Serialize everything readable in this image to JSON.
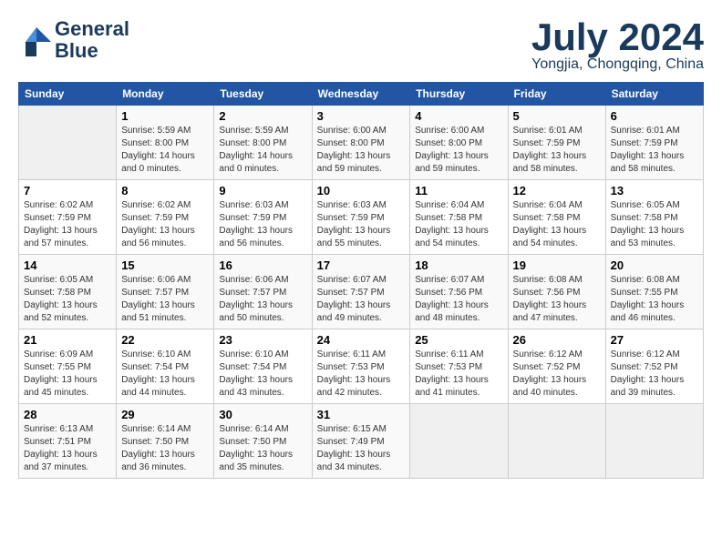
{
  "header": {
    "logo_line1": "General",
    "logo_line2": "Blue",
    "month_title": "July 2024",
    "location": "Yongjia, Chongqing, China"
  },
  "columns": [
    "Sunday",
    "Monday",
    "Tuesday",
    "Wednesday",
    "Thursday",
    "Friday",
    "Saturday"
  ],
  "weeks": [
    [
      {
        "day": "",
        "info": ""
      },
      {
        "day": "1",
        "info": "Sunrise: 5:59 AM\nSunset: 8:00 PM\nDaylight: 14 hours\nand 0 minutes."
      },
      {
        "day": "2",
        "info": "Sunrise: 5:59 AM\nSunset: 8:00 PM\nDaylight: 14 hours\nand 0 minutes."
      },
      {
        "day": "3",
        "info": "Sunrise: 6:00 AM\nSunset: 8:00 PM\nDaylight: 13 hours\nand 59 minutes."
      },
      {
        "day": "4",
        "info": "Sunrise: 6:00 AM\nSunset: 8:00 PM\nDaylight: 13 hours\nand 59 minutes."
      },
      {
        "day": "5",
        "info": "Sunrise: 6:01 AM\nSunset: 7:59 PM\nDaylight: 13 hours\nand 58 minutes."
      },
      {
        "day": "6",
        "info": "Sunrise: 6:01 AM\nSunset: 7:59 PM\nDaylight: 13 hours\nand 58 minutes."
      }
    ],
    [
      {
        "day": "7",
        "info": "Sunrise: 6:02 AM\nSunset: 7:59 PM\nDaylight: 13 hours\nand 57 minutes."
      },
      {
        "day": "8",
        "info": "Sunrise: 6:02 AM\nSunset: 7:59 PM\nDaylight: 13 hours\nand 56 minutes."
      },
      {
        "day": "9",
        "info": "Sunrise: 6:03 AM\nSunset: 7:59 PM\nDaylight: 13 hours\nand 56 minutes."
      },
      {
        "day": "10",
        "info": "Sunrise: 6:03 AM\nSunset: 7:59 PM\nDaylight: 13 hours\nand 55 minutes."
      },
      {
        "day": "11",
        "info": "Sunrise: 6:04 AM\nSunset: 7:58 PM\nDaylight: 13 hours\nand 54 minutes."
      },
      {
        "day": "12",
        "info": "Sunrise: 6:04 AM\nSunset: 7:58 PM\nDaylight: 13 hours\nand 54 minutes."
      },
      {
        "day": "13",
        "info": "Sunrise: 6:05 AM\nSunset: 7:58 PM\nDaylight: 13 hours\nand 53 minutes."
      }
    ],
    [
      {
        "day": "14",
        "info": "Sunrise: 6:05 AM\nSunset: 7:58 PM\nDaylight: 13 hours\nand 52 minutes."
      },
      {
        "day": "15",
        "info": "Sunrise: 6:06 AM\nSunset: 7:57 PM\nDaylight: 13 hours\nand 51 minutes."
      },
      {
        "day": "16",
        "info": "Sunrise: 6:06 AM\nSunset: 7:57 PM\nDaylight: 13 hours\nand 50 minutes."
      },
      {
        "day": "17",
        "info": "Sunrise: 6:07 AM\nSunset: 7:57 PM\nDaylight: 13 hours\nand 49 minutes."
      },
      {
        "day": "18",
        "info": "Sunrise: 6:07 AM\nSunset: 7:56 PM\nDaylight: 13 hours\nand 48 minutes."
      },
      {
        "day": "19",
        "info": "Sunrise: 6:08 AM\nSunset: 7:56 PM\nDaylight: 13 hours\nand 47 minutes."
      },
      {
        "day": "20",
        "info": "Sunrise: 6:08 AM\nSunset: 7:55 PM\nDaylight: 13 hours\nand 46 minutes."
      }
    ],
    [
      {
        "day": "21",
        "info": "Sunrise: 6:09 AM\nSunset: 7:55 PM\nDaylight: 13 hours\nand 45 minutes."
      },
      {
        "day": "22",
        "info": "Sunrise: 6:10 AM\nSunset: 7:54 PM\nDaylight: 13 hours\nand 44 minutes."
      },
      {
        "day": "23",
        "info": "Sunrise: 6:10 AM\nSunset: 7:54 PM\nDaylight: 13 hours\nand 43 minutes."
      },
      {
        "day": "24",
        "info": "Sunrise: 6:11 AM\nSunset: 7:53 PM\nDaylight: 13 hours\nand 42 minutes."
      },
      {
        "day": "25",
        "info": "Sunrise: 6:11 AM\nSunset: 7:53 PM\nDaylight: 13 hours\nand 41 minutes."
      },
      {
        "day": "26",
        "info": "Sunrise: 6:12 AM\nSunset: 7:52 PM\nDaylight: 13 hours\nand 40 minutes."
      },
      {
        "day": "27",
        "info": "Sunrise: 6:12 AM\nSunset: 7:52 PM\nDaylight: 13 hours\nand 39 minutes."
      }
    ],
    [
      {
        "day": "28",
        "info": "Sunrise: 6:13 AM\nSunset: 7:51 PM\nDaylight: 13 hours\nand 37 minutes."
      },
      {
        "day": "29",
        "info": "Sunrise: 6:14 AM\nSunset: 7:50 PM\nDaylight: 13 hours\nand 36 minutes."
      },
      {
        "day": "30",
        "info": "Sunrise: 6:14 AM\nSunset: 7:50 PM\nDaylight: 13 hours\nand 35 minutes."
      },
      {
        "day": "31",
        "info": "Sunrise: 6:15 AM\nSunset: 7:49 PM\nDaylight: 13 hours\nand 34 minutes."
      },
      {
        "day": "",
        "info": ""
      },
      {
        "day": "",
        "info": ""
      },
      {
        "day": "",
        "info": ""
      }
    ]
  ]
}
